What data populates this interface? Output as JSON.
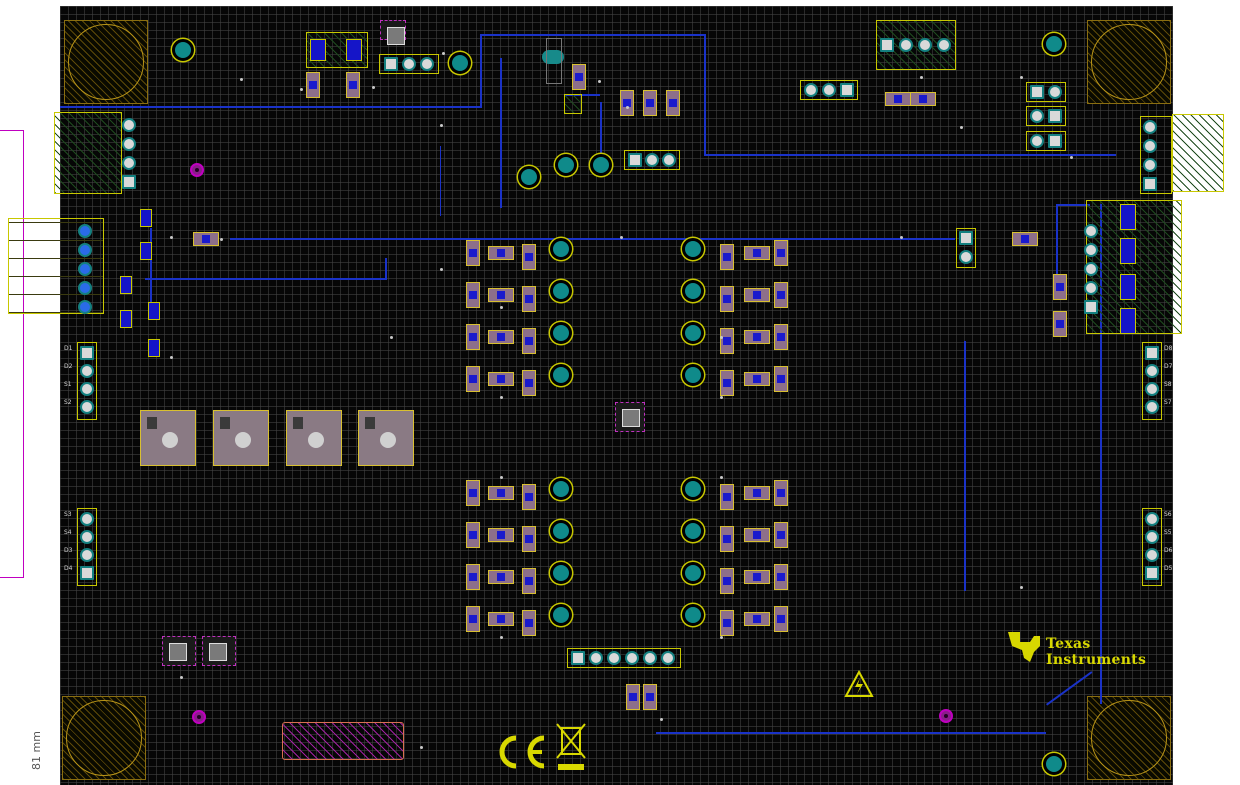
{
  "ruler": {
    "dimension_label": "81 mm"
  },
  "connectors_left": {
    "top": [
      "D1",
      "D2",
      "S1",
      "S2"
    ],
    "bottom": [
      "S3",
      "S4",
      "D3",
      "D4"
    ]
  },
  "connectors_right": {
    "top": [
      "D8",
      "D7",
      "S8",
      "S7"
    ],
    "bottom": [
      "S6",
      "S5",
      "D6",
      "D5"
    ]
  },
  "logo": {
    "line1": "Texas",
    "line2": "Instruments",
    "color": "#d8d800"
  },
  "marks": [
    "CE",
    "WEEE"
  ],
  "colors": {
    "board": "#060606",
    "copper_top": "#1a32c8",
    "silkscreen": "#c8c800",
    "via": "#c000c0",
    "pad": "#8d6f8a"
  }
}
